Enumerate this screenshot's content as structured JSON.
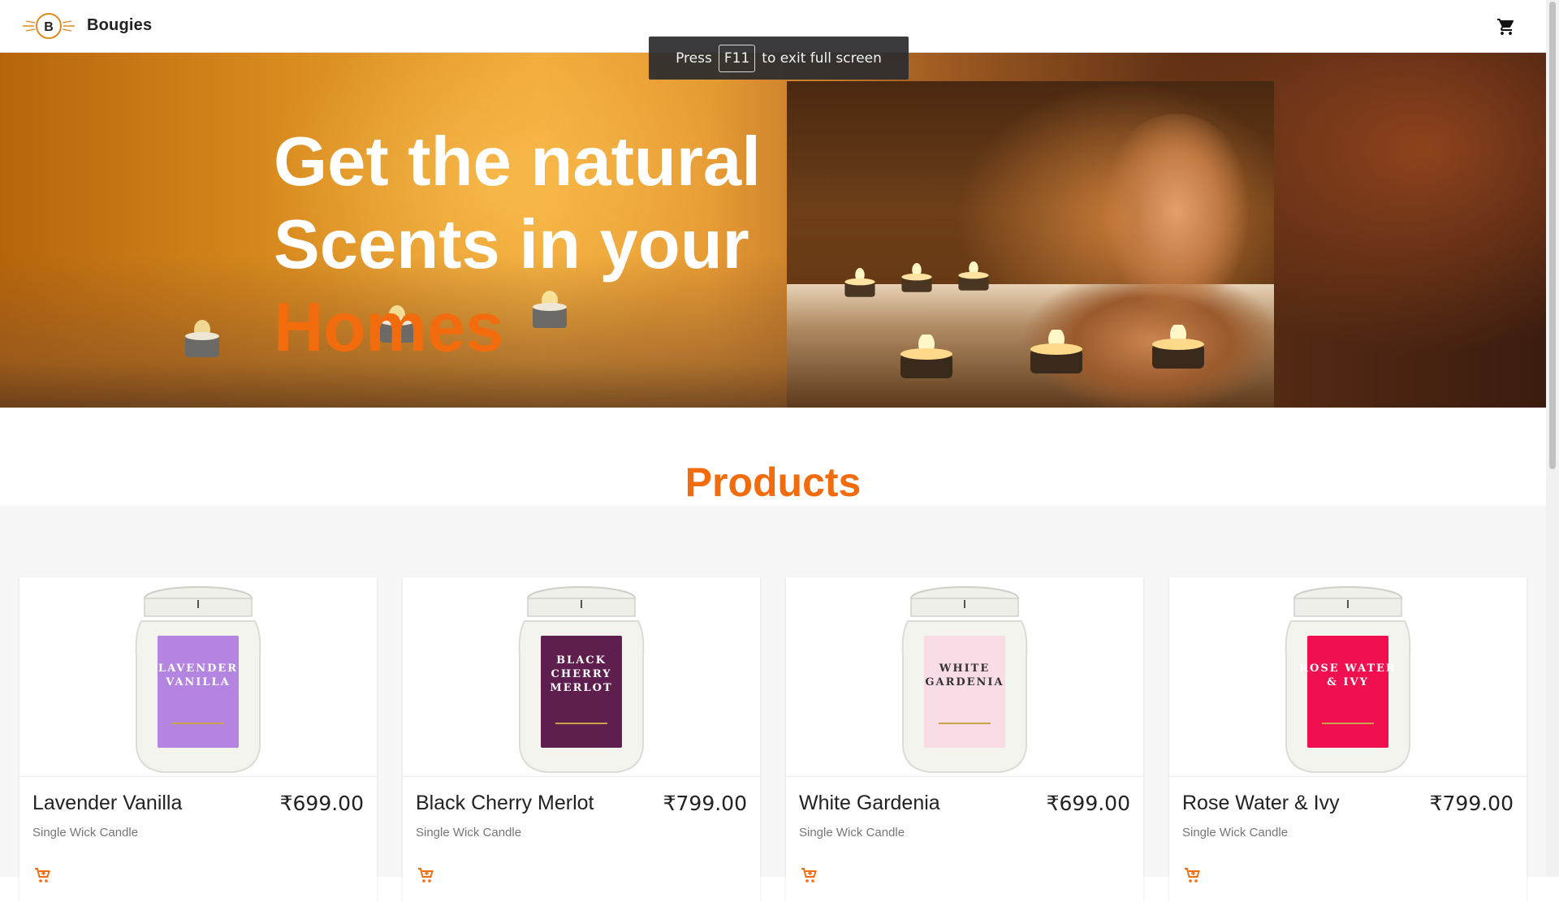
{
  "header": {
    "logo_letter": "B",
    "brand": "Bougies",
    "cart_icon": "cart-icon"
  },
  "fullscreen_toast": {
    "prefix": "Press",
    "key": "F11",
    "suffix": "to exit full screen"
  },
  "hero": {
    "line1": "Get the natural",
    "line2": "Scents in your",
    "line3": "Homes"
  },
  "products": {
    "heading": "Products",
    "items": [
      {
        "name": "Lavender Vanilla",
        "price": "₹699.00",
        "subtitle": "Single Wick Candle",
        "label_text": [
          "LAVENDER",
          "VANILLA"
        ],
        "label_color": "#b384e0"
      },
      {
        "name": "Black Cherry Merlot",
        "price": "₹799.00",
        "subtitle": "Single Wick Candle",
        "label_text": [
          "BLACK",
          "CHERRY",
          "MERLOT"
        ],
        "label_color": "#5e1f4f"
      },
      {
        "name": "White Gardenia",
        "price": "₹699.00",
        "subtitle": "Single Wick Candle",
        "label_text": [
          "WHITE",
          "GARDENIA"
        ],
        "label_color": "#f9dce6"
      },
      {
        "name": "Rose Water & Ivy",
        "price": "₹799.00",
        "subtitle": "Single Wick Candle",
        "label_text": [
          "ROSE WATER",
          "& IVY"
        ],
        "label_color": "#f0104f"
      }
    ]
  },
  "colors": {
    "accent": "#f26c0d",
    "text": "#222222"
  }
}
